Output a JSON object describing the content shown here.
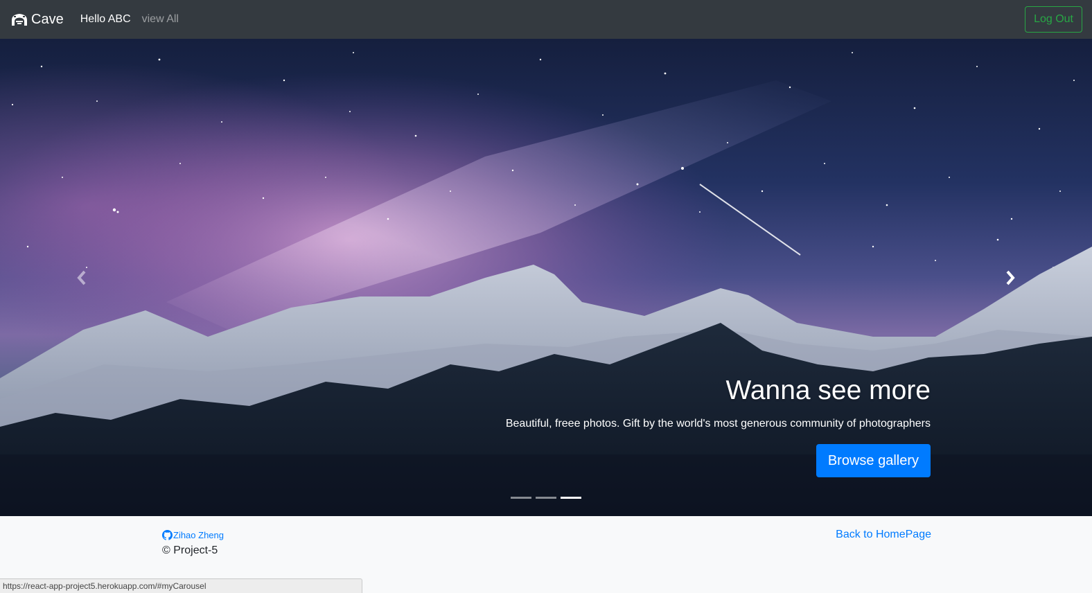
{
  "navbar": {
    "brand": "Cave",
    "brand_icon": "cave-icon",
    "links": [
      {
        "label": "Hello ABC",
        "active": true
      },
      {
        "label": "view All",
        "active": false
      }
    ],
    "logout_label": "Log Out"
  },
  "carousel": {
    "slide_image": "night-sky-mountains-image",
    "heading": "Wanna see more",
    "subtitle": "Beautiful, freee photos. Gift by the world's most generous community of photographers",
    "cta_label": "Browse gallery",
    "indicators": [
      {
        "active": false
      },
      {
        "active": false
      },
      {
        "active": true
      }
    ],
    "prev_icon": "chevron-left-icon",
    "next_icon": "chevron-right-icon"
  },
  "footer": {
    "author": "Zihao Zheng",
    "author_icon": "github-icon",
    "copyright": "© Project-5",
    "back_link": "Back to HomePage"
  },
  "status_bar": {
    "url": "https://react-app-project5.herokuapp.com/#myCarousel"
  },
  "colors": {
    "navbar_bg": "#343a40",
    "logout_green": "#28a745",
    "primary_blue": "#007bff",
    "footer_bg": "#f8f9fa"
  }
}
